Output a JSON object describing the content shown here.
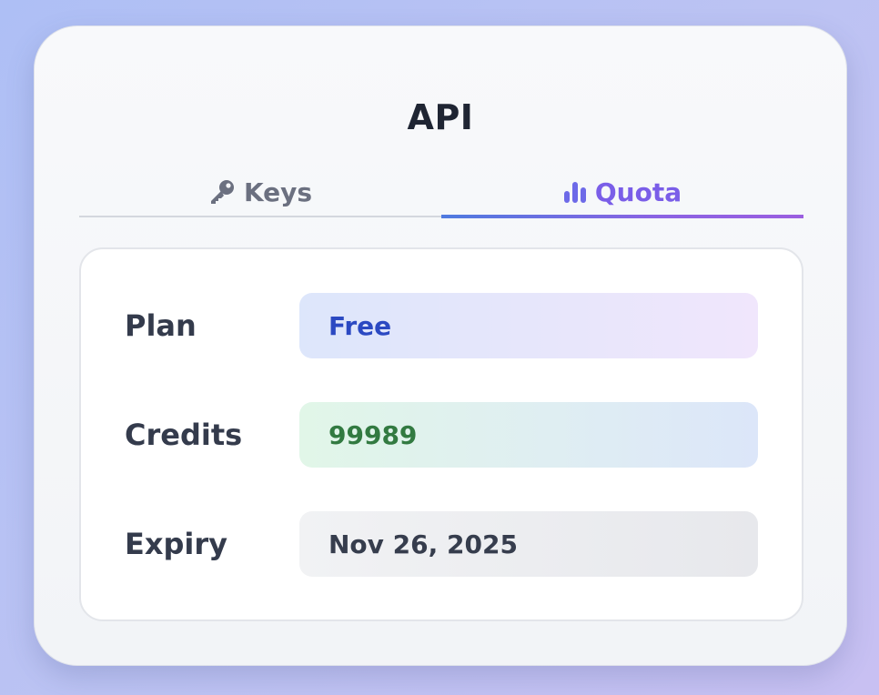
{
  "header": {
    "title": "API"
  },
  "tabs": [
    {
      "label": "Keys",
      "icon": "key-icon",
      "active": false
    },
    {
      "label": "Quota",
      "icon": "bar-chart-icon",
      "active": true
    }
  ],
  "quota": {
    "plan": {
      "label": "Plan",
      "value": "Free"
    },
    "credits": {
      "label": "Credits",
      "value": "99989"
    },
    "expiry": {
      "label": "Expiry",
      "value": "Nov 26, 2025"
    }
  },
  "colors": {
    "accent": "#7a5ee8",
    "plan_text": "#2b49c2",
    "credits_text": "#327a41"
  }
}
